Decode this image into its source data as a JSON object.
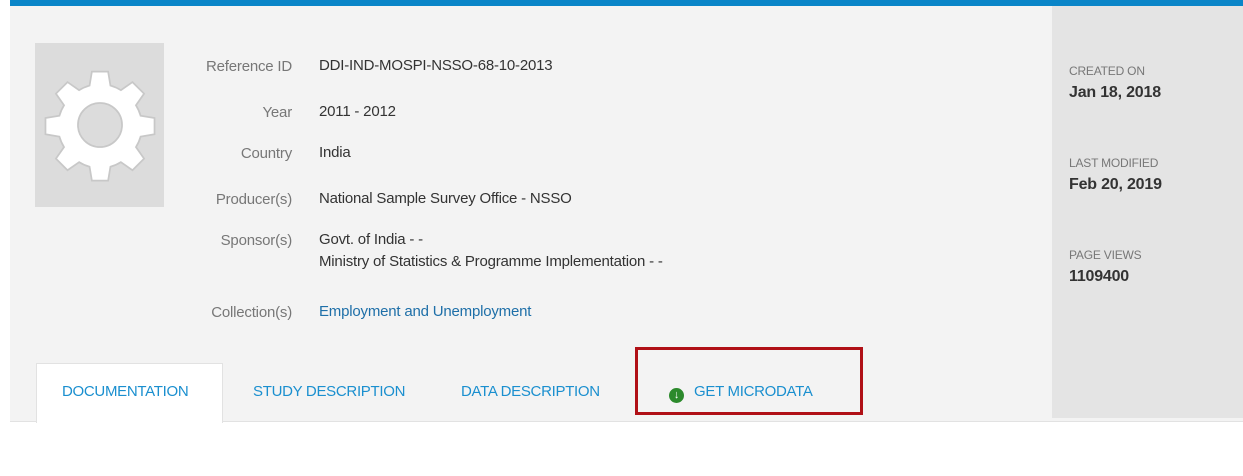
{
  "study": {
    "fields": [
      {
        "label": "Reference ID",
        "value": "DDI-IND-MOSPI-NSSO-68-10-2013"
      },
      {
        "label": "Year",
        "value": "2011 - 2012"
      },
      {
        "label": "Country",
        "value": "India"
      },
      {
        "label": "Producer(s)",
        "value": "National Sample Survey Office - NSSO"
      },
      {
        "label": "Sponsor(s)",
        "values": [
          "Govt. of India - -",
          "Ministry of Statistics & Programme Implementation - -"
        ]
      },
      {
        "label": "Collection(s)",
        "value": "Employment and Unemployment"
      }
    ]
  },
  "stats": {
    "created_label": "CREATED ON",
    "created_value": "Jan 18, 2018",
    "modified_label": "LAST MODIFIED",
    "modified_value": "Feb 20, 2019",
    "views_label": "PAGE VIEWS",
    "views_value": "1109400"
  },
  "tabs": [
    {
      "label": "DOCUMENTATION",
      "active": true
    },
    {
      "label": "STUDY DESCRIPTION",
      "active": false
    },
    {
      "label": "DATA DESCRIPTION",
      "active": false
    },
    {
      "label": "GET MICRODATA",
      "active": false,
      "icon": "download-circle-icon"
    }
  ],
  "colors": {
    "accent": "#0a85c8",
    "link": "#1e6fa8",
    "highlight": "#b01016",
    "download_icon": "#2c8a2c"
  }
}
